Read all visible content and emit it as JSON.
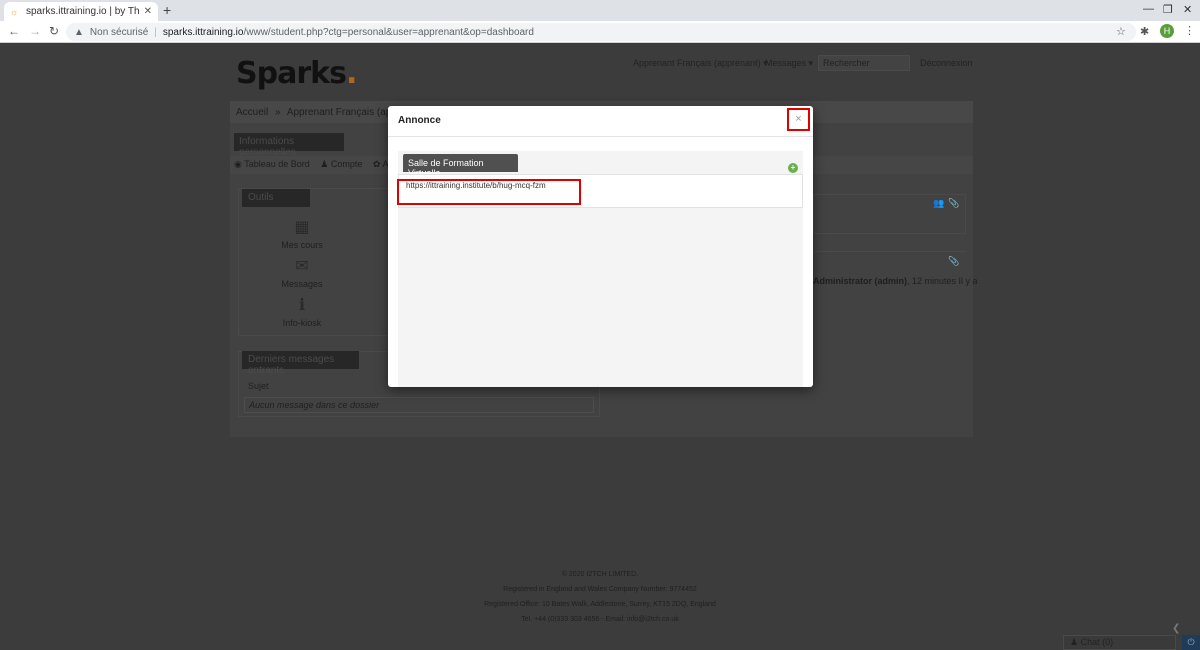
{
  "browser": {
    "tab_title": "sparks.ittraining.io | by The IT",
    "tab_close": "✕",
    "new_tab": "+",
    "security_label": "Non sécurisé",
    "url_domain": "sparks.ittraining.io",
    "url_path": "/www/student.php?ctg=personal&user=apprenant&op=dashboard",
    "profile_initial": "H"
  },
  "site": {
    "logo": "Sparks",
    "logo_dot": ".",
    "user_menu": "Apprenant Français (apprenant) ▾",
    "messages_menu": "Messages ▾",
    "search_placeholder": "Rechercher",
    "logout": "Déconnexion"
  },
  "breadcrumb": {
    "home": "Accueil",
    "sep": "»",
    "current": "Apprenant Français (appren"
  },
  "main": {
    "info_button": "Informations personnelles",
    "subtabs": {
      "dashboard": "Tableau de Bord",
      "account": "Compte",
      "other": "App"
    },
    "outils_title": "Outils",
    "tools": [
      {
        "label": "Mes cours",
        "icon": "courses-icon"
      },
      {
        "label": "Messages",
        "icon": "envelope-icon"
      },
      {
        "label": "Info-kiosk",
        "icon": "info-icon"
      }
    ],
    "messages_title": "Derniers messages entrants",
    "subject_header": "Sujet",
    "no_messages": "Aucun message dans ce dossier",
    "right_info_name": "Administrator (admin)",
    "right_info_time": ", 12 minutes Il y a"
  },
  "modal": {
    "title": "Annonce",
    "close_glyph": "×",
    "panel_title": "Salle de Formation Virtuelle",
    "link": "https://ittraining.institute/b/hug-mcq-fzm"
  },
  "footer": {
    "lines": [
      "© 2020 I2TCH LIMITED.",
      "Registered in England and Wales Company Number: 9774452",
      "Registered Office: 10 Bates Walk, Addlestone, Surrey, KT15 2DQ, England",
      "Tel. +44 (0)333 303 4656 - Email: info@i2tch.co.uk"
    ]
  },
  "chat": {
    "label": "Chat (0)"
  },
  "colors": {
    "accent_red": "#e00000",
    "logo_dot": "#b5651d",
    "panel_tab": "#505050",
    "plus_green": "#6ab04c"
  }
}
